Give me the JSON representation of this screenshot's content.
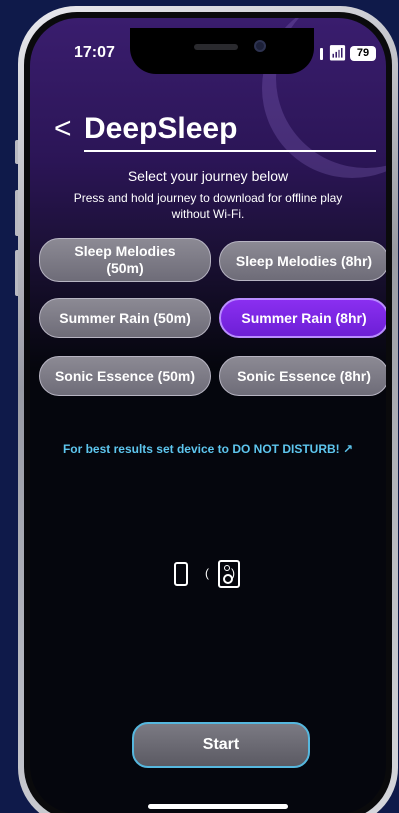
{
  "status_bar": {
    "time": "17:07",
    "battery": "79"
  },
  "header": {
    "back_glyph": "<",
    "title": "DeepSleep"
  },
  "instructions": {
    "line1": "Select your journey below",
    "line2": "Press and hold journey to download for offline play without Wi-Fi."
  },
  "journeys": [
    {
      "label": "Sleep Melodies (50m)",
      "selected": false
    },
    {
      "label": "Sleep Melodies (8hr)",
      "selected": false
    },
    {
      "label": "Summer Rain (50m)",
      "selected": false
    },
    {
      "label": "Summer Rain (8hr)",
      "selected": true
    },
    {
      "label": "Sonic Essence (50m)",
      "selected": false
    },
    {
      "label": "Sonic Essence (8hr)",
      "selected": false
    }
  ],
  "dnd_notice": "For best results set device to DO NOT DISTURB! ↗",
  "icons": [
    "phone-connect-icon",
    "speaker-icon"
  ],
  "start_button": "Start",
  "colors": {
    "accent": "#7a28e8",
    "link": "#5ec6ee",
    "background": "#0f1a4a"
  }
}
